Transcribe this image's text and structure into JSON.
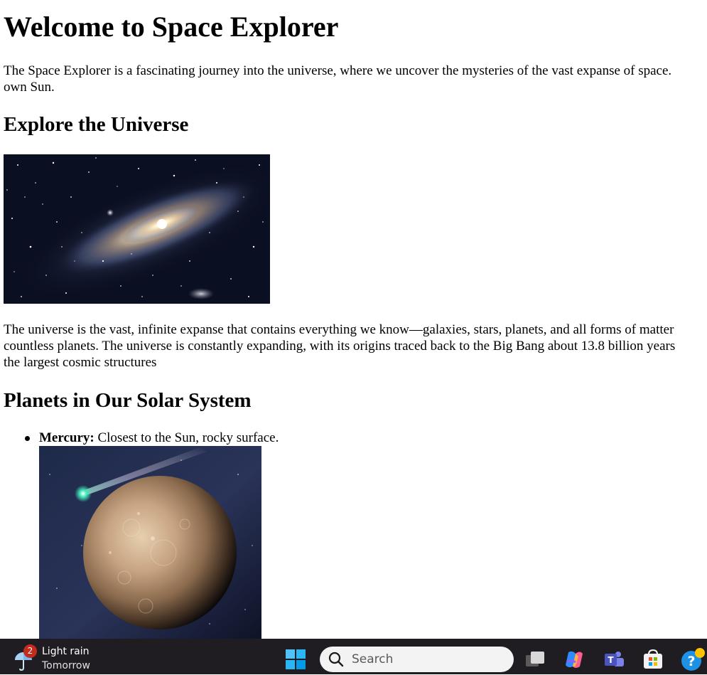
{
  "page": {
    "title": "Welcome to Space Explorer",
    "intro_lines": [
      "The Space Explorer is a fascinating journey into the universe, where we uncover the mysteries of the vast expanse of space.",
      "own Sun."
    ],
    "explore_heading": "Explore the Universe",
    "universe_lines": [
      "The universe is the vast, infinite expanse that contains everything we know—galaxies, stars, planets, and all forms of matter",
      "countless planets. The universe is constantly expanding, with its origins traced back to the Big Bang about 13.8 billion years",
      "the largest cosmic structures"
    ],
    "planets_heading": "Planets in Our Solar System",
    "planets": [
      {
        "name": "Mercury:",
        "description": " Closest to the Sun, rocky surface."
      }
    ]
  },
  "taskbar": {
    "weather": {
      "badge": "2",
      "condition": "Light rain",
      "when": "Tomorrow",
      "icon": "umbrella-rain-icon"
    },
    "search": {
      "placeholder": "Search"
    },
    "icons": [
      "windows-start-icon",
      "task-view-icon",
      "copilot-icon",
      "teams-icon",
      "microsoft-store-icon",
      "help-icon"
    ]
  }
}
